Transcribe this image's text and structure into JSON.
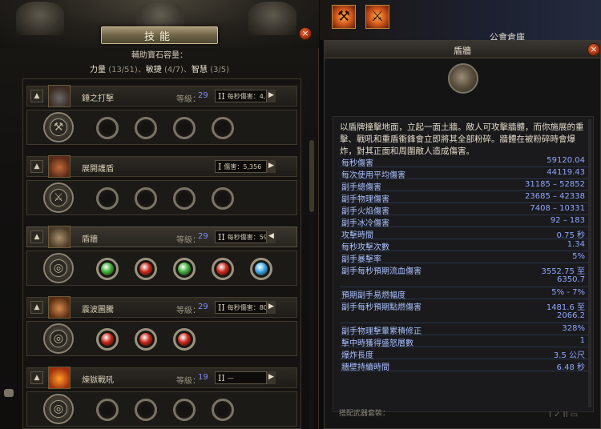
{
  "left_panel": {
    "title": "技能",
    "close_label": "×",
    "gem_capacity": {
      "label": "輔助寶石容量：",
      "strength_label": "力量",
      "strength_value": "(13/51)",
      "dex_label": "敏捷",
      "dex_value": "(4/7)",
      "int_label": "智慧",
      "int_value": "(3/5)",
      "sep": "、"
    },
    "skills": [
      {
        "name": "錘之打擊",
        "level_label": "等級：",
        "level": "29",
        "stat_bars": "II",
        "stat_text": "每秒傷害：4,455",
        "arrow": "▶",
        "rank": "▲",
        "weapon": "⚒",
        "gems": [
          "empty",
          "empty",
          "empty",
          "empty"
        ]
      },
      {
        "name": "展開護盾",
        "level_label": "",
        "level": "",
        "stat_bars": "I",
        "stat_text": "傷害：5,356",
        "arrow": "▶",
        "rank": "▲",
        "weapon": "⚔",
        "gems": [
          "empty",
          "empty",
          "empty",
          "empty"
        ]
      },
      {
        "name": "盾牆",
        "level_label": "等級：",
        "level": "29",
        "stat_bars": "II",
        "stat_text": "每秒傷害：59,120",
        "arrow": "◀",
        "rank": "▲",
        "weapon": "◎",
        "gems": [
          "green",
          "red",
          "green",
          "red",
          "blue"
        ]
      },
      {
        "name": "震波圖騰",
        "level_label": "等級：",
        "level": "29",
        "stat_bars": "II",
        "stat_text": "每秒傷害：805",
        "arrow": "▶",
        "rank": "▲",
        "weapon": "◎",
        "gems": [
          "red",
          "red",
          "red"
        ]
      },
      {
        "name": "煉獄戰吼",
        "level_label": "等級：",
        "level": "19",
        "stat_bars": "II",
        "stat_text": "—",
        "arrow": "▶",
        "rank": "▲",
        "weapon": "◎",
        "gems": []
      }
    ],
    "gem_colors": {
      "green": "#3fae3a",
      "red": "#c8281a",
      "blue": "#3aa8e8"
    }
  },
  "top_bar": {
    "guild_storage": "公會倉庫"
  },
  "tooltip": {
    "title": "盾牆",
    "close_label": "×",
    "description": "以盾牌撞擊地面，立起一面土牆。敵人可攻擊牆體，而你施展的重擊、戰吼和重盾衝鋒會立即將其全部粉碎。牆體在被粉碎時會爆炸，對其正面和周圍敵人造成傷害。",
    "stats": [
      {
        "name": "每秒傷害",
        "value": "59120.04"
      },
      {
        "name": "每次使用平均傷害",
        "value": "44119.43"
      },
      {
        "name": "副手總傷害",
        "value": "31185 – 52852"
      },
      {
        "name": "副手物理傷害",
        "value": "23685 – 42338"
      },
      {
        "name": "副手火焰傷害",
        "value": "7408 – 10331"
      },
      {
        "name": "副手冰冷傷害",
        "value": "92 – 183"
      },
      {
        "name": "攻擊時間",
        "value": "0.75 秒"
      },
      {
        "name": "每秒攻擊次數",
        "value": "1.34"
      },
      {
        "name": "副手暴擊率",
        "value": "5%"
      },
      {
        "name": "副手每秒預期流血傷害",
        "value": "3552.75 至",
        "value2": "6350.7"
      },
      {
        "name": "預期副手易燃幅度",
        "value": "5% - 7%"
      },
      {
        "name": "副手每秒預期點燃傷害",
        "value": "1481.6 至",
        "value2": "2066.2"
      },
      {
        "name": "副手物理擊暈累積修正",
        "value": "328%"
      },
      {
        "name": "擊中時獲得盛怒層數",
        "value": "1"
      },
      {
        "name": "爆炸長度",
        "value": "3.5 公尺"
      },
      {
        "name": "牆壁持續時間",
        "value": "6.48 秒"
      }
    ],
    "footer_label": "搭配武器套裝：",
    "footer_icons": "I ✓   II ▭"
  }
}
